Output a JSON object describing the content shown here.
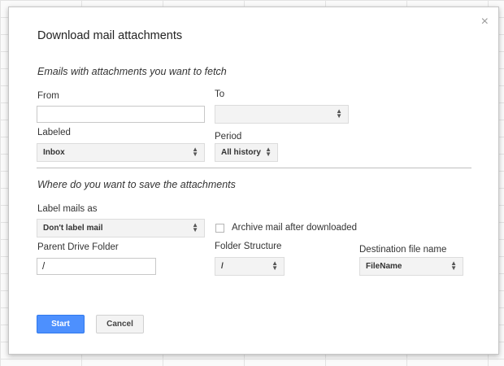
{
  "dialog": {
    "title": "Download mail attachments",
    "close_glyph": "×",
    "close_icon": "close-icon"
  },
  "fetch_section": {
    "heading": "Emails with attachments you want to fetch",
    "from": {
      "label": "From",
      "value": "",
      "placeholder": ""
    },
    "to": {
      "label": "To",
      "value": ""
    },
    "labeled": {
      "label": "Labeled",
      "value": "Inbox"
    },
    "period": {
      "label": "Period",
      "value": "All history"
    }
  },
  "save_section": {
    "heading": "Where do you want to save the attachments",
    "label_mails_as": {
      "label": "Label mails as",
      "value": "Don't label mail"
    },
    "archive": {
      "label": "Archive mail after downloaded",
      "checked": false
    },
    "parent_folder": {
      "label": "Parent Drive Folder",
      "value": "/"
    },
    "folder_structure": {
      "label": "Folder Structure",
      "value": "/"
    },
    "destination_name": {
      "label": "Destination file name",
      "value": "FileName"
    }
  },
  "actions": {
    "start_label": "Start",
    "cancel_label": "Cancel"
  },
  "select_arrows": "▲▼",
  "colors": {
    "primary_button": "#4d90fe",
    "primary_border": "#3079ed",
    "divider": "#bfbfbf"
  }
}
